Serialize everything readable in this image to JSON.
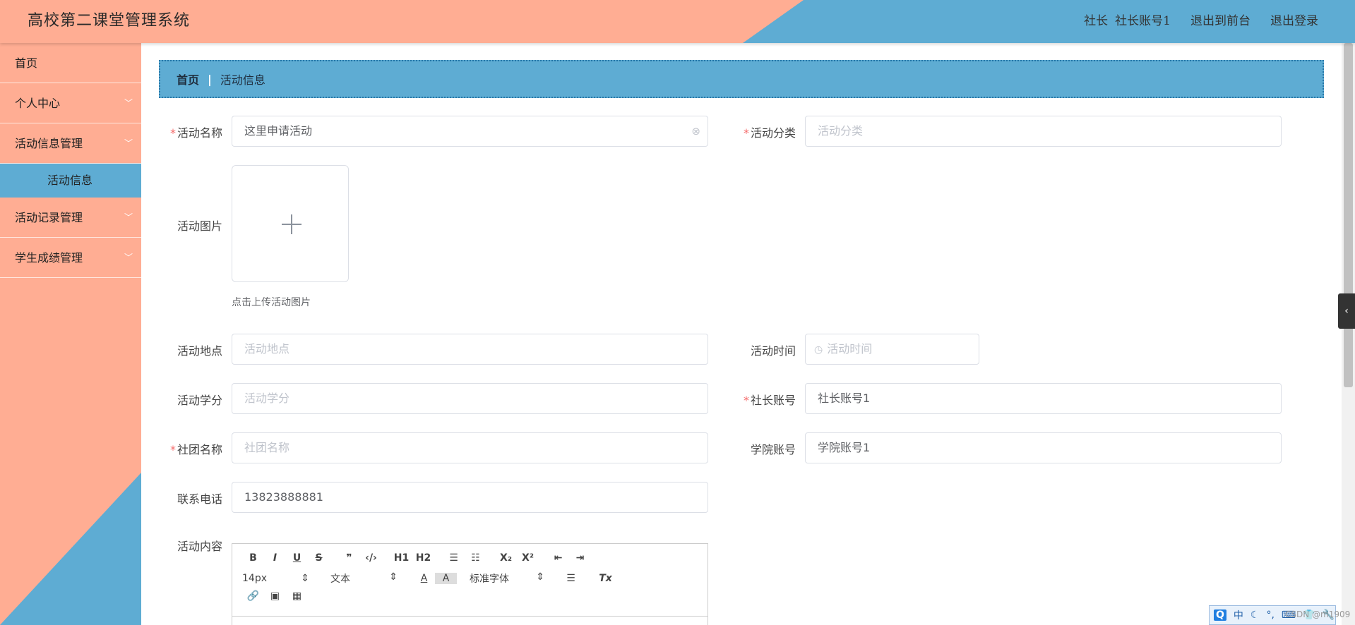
{
  "header": {
    "title": "高校第二课堂管理系统",
    "role": "社长",
    "account": "社长账号1",
    "exit_front": "退出到前台",
    "logout": "退出登录"
  },
  "sidebar": {
    "items": [
      {
        "label": "首页"
      },
      {
        "label": "个人中心",
        "chevron": "﹀"
      },
      {
        "label": "活动信息管理",
        "chevron": "﹀"
      },
      {
        "label": "活动信息"
      },
      {
        "label": "活动记录管理",
        "chevron": "﹀"
      },
      {
        "label": "学生成绩管理",
        "chevron": "﹀"
      }
    ]
  },
  "breadcrumb": {
    "home": "首页",
    "separator": "|",
    "current": "活动信息"
  },
  "form": {
    "required_mark": "*",
    "name": {
      "label": "活动名称",
      "value": "这里申请活动"
    },
    "category": {
      "label": "活动分类",
      "placeholder": "活动分类"
    },
    "image": {
      "label": "活动图片",
      "tip": "点击上传活动图片"
    },
    "location": {
      "label": "活动地点",
      "placeholder": "活动地点"
    },
    "time": {
      "label": "活动时间",
      "placeholder": "活动时间"
    },
    "credit": {
      "label": "活动学分",
      "placeholder": "活动学分"
    },
    "leader_account": {
      "label": "社长账号",
      "value": "社长账号1"
    },
    "club_name": {
      "label": "社团名称",
      "placeholder": "社团名称"
    },
    "college_account": {
      "label": "学院账号",
      "value": "学院账号1"
    },
    "phone": {
      "label": "联系电话",
      "value": "13823888881"
    },
    "content": {
      "label": "活动内容"
    }
  },
  "editor": {
    "bold": "B",
    "italic": "I",
    "underline": "U",
    "strike": "S",
    "quote": "❞",
    "code": "‹/›",
    "h1": "H1",
    "h2": "H2",
    "ol": "☰",
    "ul": "☷",
    "sub": "X₂",
    "sup": "X²",
    "outdent": "⇤",
    "indent": "⇥",
    "size": "14px",
    "header": "文本",
    "color": "A",
    "bg": "A",
    "font": "标准字体",
    "align": "☰",
    "clean": "Tx",
    "link": "🔗",
    "image": "▣",
    "video": "▦",
    "arrow": "⇕"
  },
  "side_tab": "‹",
  "ime": {
    "logo": "Q",
    "mode": "中",
    "moon": "☾",
    "dot": "°,",
    "kbd": "⌨",
    "shirt": "👕",
    "tool": "🔧"
  },
  "watermark": "CSDN @m1909",
  "colors": {
    "salmon": "#ffad93",
    "blue": "#5eacd3",
    "required": "#f56c6c"
  }
}
